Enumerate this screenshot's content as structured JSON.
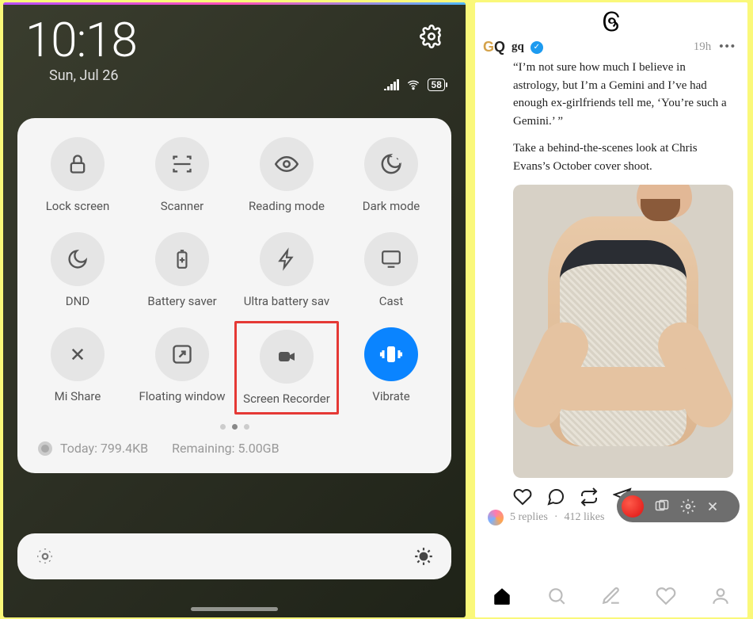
{
  "left": {
    "time": "10:18",
    "date": "Sun, Jul 26",
    "battery": "58",
    "tiles": [
      {
        "label": "Lock screen",
        "icon": "lock"
      },
      {
        "label": "Scanner",
        "icon": "scan"
      },
      {
        "label": "Reading mode",
        "icon": "eye"
      },
      {
        "label": "Dark mode",
        "icon": "dark"
      },
      {
        "label": "DND",
        "icon": "moon"
      },
      {
        "label": "Battery saver",
        "icon": "batplus"
      },
      {
        "label": "Ultra battery sav",
        "icon": "bolt"
      },
      {
        "label": "Cast",
        "icon": "cast"
      },
      {
        "label": "Mi Share",
        "icon": "mishare"
      },
      {
        "label": "Floating window",
        "icon": "floatwin"
      },
      {
        "label": "Screen Recorder",
        "icon": "camcorder",
        "highlight": true
      },
      {
        "label": "Vibrate",
        "icon": "vibrate",
        "active": true
      }
    ],
    "today_label": "Today: 799.4KB",
    "remaining_label": "Remaining: 5.00GB"
  },
  "right": {
    "account": "gq",
    "timestamp": "19h",
    "body_para1": "“I’m not sure how much I believe in astrology, but I’m a Gemini and I’ve had enough ex-girlfriends tell me, ‘You’re such a Gemini.’ ”",
    "body_para2": "Take a behind-the-scenes look at Chris Evans’s October cover shoot.",
    "replies": "5 replies",
    "likes": "412 likes",
    "dot": "·"
  }
}
